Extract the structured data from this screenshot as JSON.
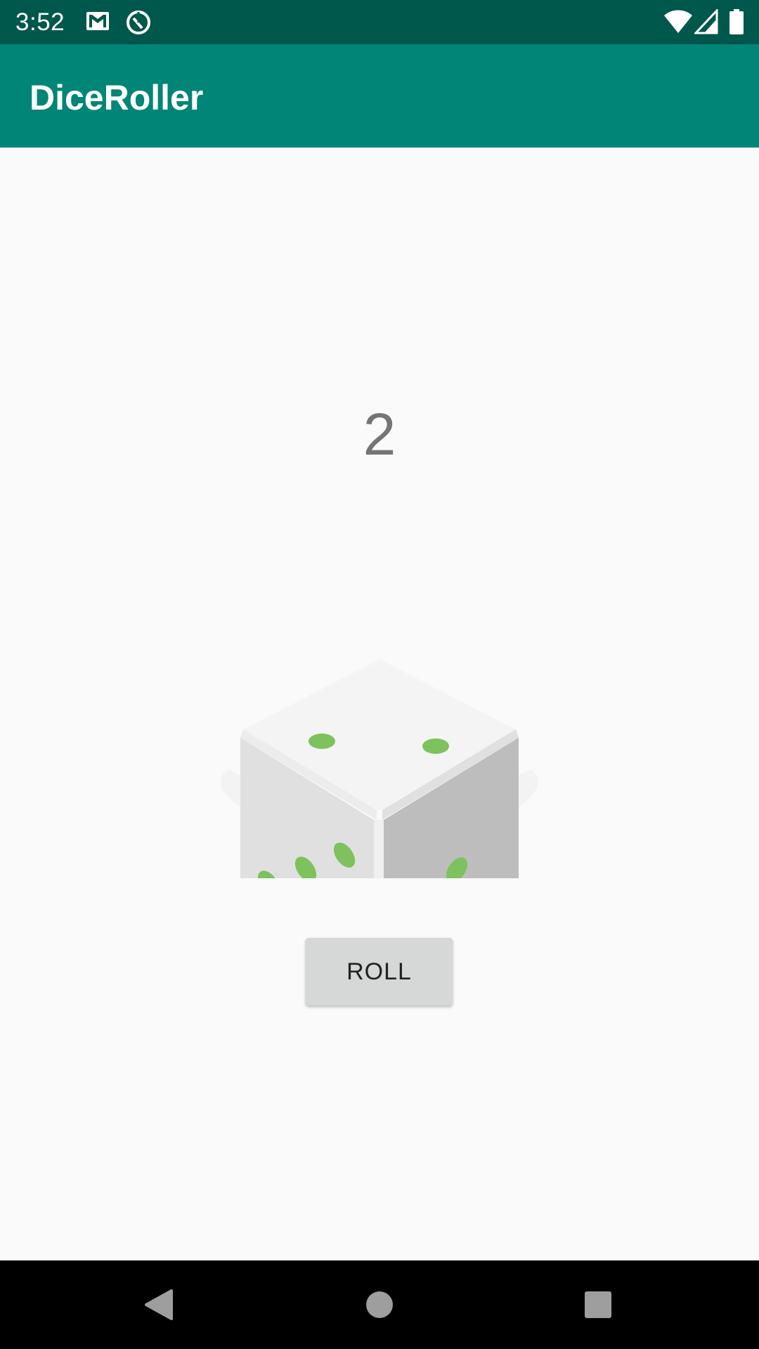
{
  "status_bar": {
    "time": "3:52",
    "left_icons": [
      "gmail-icon",
      "sync-icon"
    ],
    "right_icons": [
      "wifi-icon",
      "cellular-signal-icon",
      "battery-icon"
    ]
  },
  "app_bar": {
    "title": "DiceRoller"
  },
  "main": {
    "result_text": "2",
    "dice_image": {
      "top_face_pips": 2,
      "left_face_pips": 3,
      "right_face_pips": 1,
      "pip_color": "#7dc25c"
    },
    "roll_button_label": "ROLL"
  },
  "nav_bar": {
    "buttons": [
      "back-icon",
      "home-icon",
      "recents-icon"
    ]
  },
  "colors": {
    "status_bar": "#00574b",
    "app_bar": "#008577",
    "background": "#fafafa",
    "button": "#d6d7d7"
  }
}
